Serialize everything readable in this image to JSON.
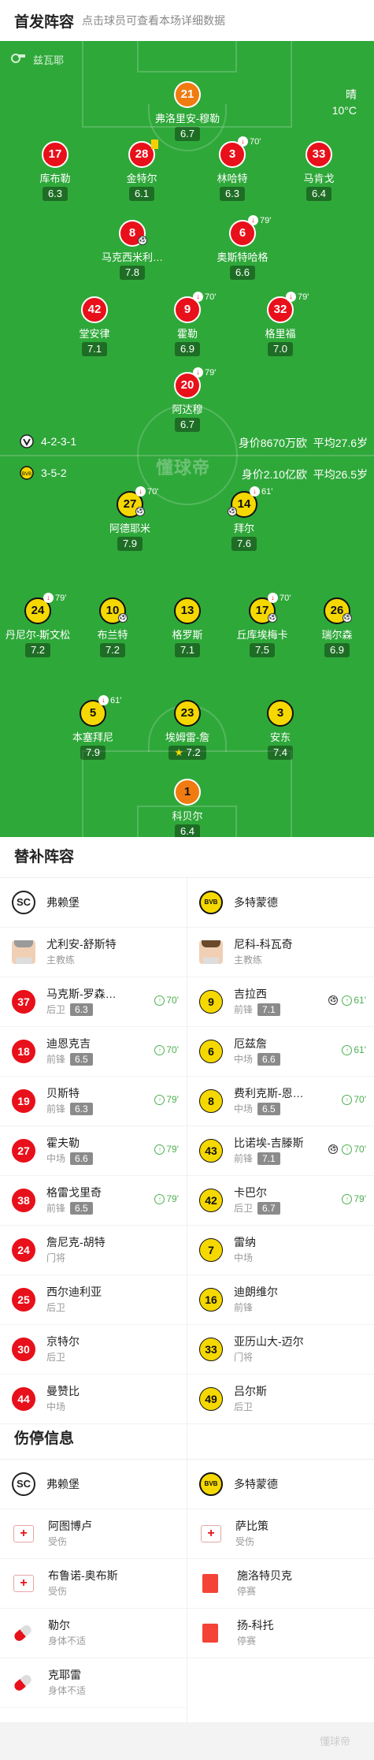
{
  "header": {
    "title": "首发阵容",
    "subtitle": "点击球员可查看本场详细数据"
  },
  "pitch": {
    "referee": "兹瓦耶",
    "weather": "晴",
    "temp": "10°C",
    "watermark": "懂球帝",
    "home": {
      "formation": "4-2-3-1",
      "value": "身价8670万欧",
      "age": "平均27.6岁"
    },
    "away": {
      "formation": "3-5-2",
      "value": "身价2.10亿欧",
      "age": "平均26.5岁"
    },
    "home_players": [
      {
        "n": "21",
        "name": "弗洛里安-穆勒",
        "r": "6.7"
      },
      {
        "n": "17",
        "name": "库布勒",
        "r": "6.3"
      },
      {
        "n": "28",
        "name": "金特尔",
        "r": "6.1"
      },
      {
        "n": "3",
        "name": "林哈特",
        "r": "6.3",
        "sub": "70'"
      },
      {
        "n": "33",
        "name": "马肯戈",
        "r": "6.4"
      },
      {
        "n": "8",
        "name": "马克西米利…",
        "r": "7.8"
      },
      {
        "n": "6",
        "name": "奥斯特哈格",
        "r": "6.6",
        "sub": "79'"
      },
      {
        "n": "42",
        "name": "堂安律",
        "r": "7.1"
      },
      {
        "n": "9",
        "name": "霍勒",
        "r": "6.9",
        "sub": "70'"
      },
      {
        "n": "32",
        "name": "格里福",
        "r": "7.0",
        "sub": "79'"
      },
      {
        "n": "20",
        "name": "阿达穆",
        "r": "6.7",
        "sub": "79'"
      }
    ],
    "away_players": [
      {
        "n": "27",
        "name": "阿德耶米",
        "r": "7.9",
        "sub": "70'"
      },
      {
        "n": "14",
        "name": "拜尔",
        "r": "7.6",
        "sub": "61'"
      },
      {
        "n": "24",
        "name": "丹尼尔-斯文松",
        "r": "7.2",
        "sub": "79'"
      },
      {
        "n": "10",
        "name": "布兰特",
        "r": "7.2"
      },
      {
        "n": "13",
        "name": "格罗斯",
        "r": "7.1"
      },
      {
        "n": "17",
        "name": "丘库埃梅卡",
        "r": "7.5",
        "sub": "70'"
      },
      {
        "n": "26",
        "name": "瑞尔森",
        "r": "6.9"
      },
      {
        "n": "5",
        "name": "本塞拜尼",
        "r": "7.9",
        "sub": "61'"
      },
      {
        "n": "23",
        "name": "埃姆雷-詹",
        "r": "7.2"
      },
      {
        "n": "3",
        "name": "安东",
        "r": "7.4"
      },
      {
        "n": "1",
        "name": "科贝尔",
        "r": "6.4"
      }
    ]
  },
  "subs": {
    "title": "替补阵容",
    "home_team": "弗赖堡",
    "away_team": "多特蒙德",
    "home_coach": {
      "name": "尤利安-舒斯特",
      "role": "主教练"
    },
    "away_coach": {
      "name": "尼科-科瓦奇",
      "role": "主教练"
    },
    "home": [
      {
        "n": "37",
        "name": "马克斯-罗森…",
        "pos": "后卫",
        "r": "6.3",
        "in": "70'"
      },
      {
        "n": "18",
        "name": "迪恩克吉",
        "pos": "前锋",
        "r": "6.5",
        "in": "70'"
      },
      {
        "n": "19",
        "name": "贝斯特",
        "pos": "前锋",
        "r": "6.3",
        "in": "79'"
      },
      {
        "n": "27",
        "name": "霍夫勒",
        "pos": "中场",
        "r": "6.6",
        "in": "79'"
      },
      {
        "n": "38",
        "name": "格雷戈里奇",
        "pos": "前锋",
        "r": "6.5",
        "in": "79'"
      },
      {
        "n": "24",
        "name": "詹尼克-胡特",
        "pos": "门将"
      },
      {
        "n": "25",
        "name": "西尔迪利亚",
        "pos": "后卫"
      },
      {
        "n": "30",
        "name": "京特尔",
        "pos": "后卫"
      },
      {
        "n": "44",
        "name": "曼赞比",
        "pos": "中场"
      }
    ],
    "away": [
      {
        "n": "9",
        "name": "吉拉西",
        "pos": "前锋",
        "r": "7.1",
        "in": "61'",
        "goal": true
      },
      {
        "n": "6",
        "name": "厄兹詹",
        "pos": "中场",
        "r": "6.6",
        "in": "61'"
      },
      {
        "n": "8",
        "name": "费利克斯-恩…",
        "pos": "中场",
        "r": "6.5",
        "in": "70'"
      },
      {
        "n": "43",
        "name": "比诺埃-吉滕斯",
        "pos": "前锋",
        "r": "7.1",
        "in": "70'",
        "goal": true
      },
      {
        "n": "42",
        "name": "卡巴尔",
        "pos": "后卫",
        "r": "6.7",
        "in": "79'"
      },
      {
        "n": "7",
        "name": "雷纳",
        "pos": "中场"
      },
      {
        "n": "16",
        "name": "迪朗维尔",
        "pos": "前锋"
      },
      {
        "n": "33",
        "name": "亚历山大-迈尔",
        "pos": "门将"
      },
      {
        "n": "49",
        "name": "吕尔斯",
        "pos": "后卫"
      }
    ]
  },
  "injuries": {
    "title": "伤停信息",
    "home_team": "弗赖堡",
    "away_team": "多特蒙德",
    "home": [
      {
        "name": "阿图博卢",
        "status": "受伤",
        "icon": "injury-icon"
      },
      {
        "name": "布鲁诺-奥布斯",
        "status": "受伤",
        "icon": "injury-icon"
      },
      {
        "name": "勒尔",
        "status": "身体不适",
        "icon": "pill-icon"
      },
      {
        "name": "克耶雷",
        "status": "身体不适",
        "icon": "pill-icon"
      }
    ],
    "away": [
      {
        "name": "萨比策",
        "status": "受伤",
        "icon": "injury-icon"
      },
      {
        "name": "施洛特贝克",
        "status": "停赛",
        "icon": "red-card-icon"
      },
      {
        "name": "扬-科托",
        "status": "停赛",
        "icon": "red-card-icon"
      }
    ]
  },
  "footer": {
    "watermark": "懂球帝"
  }
}
